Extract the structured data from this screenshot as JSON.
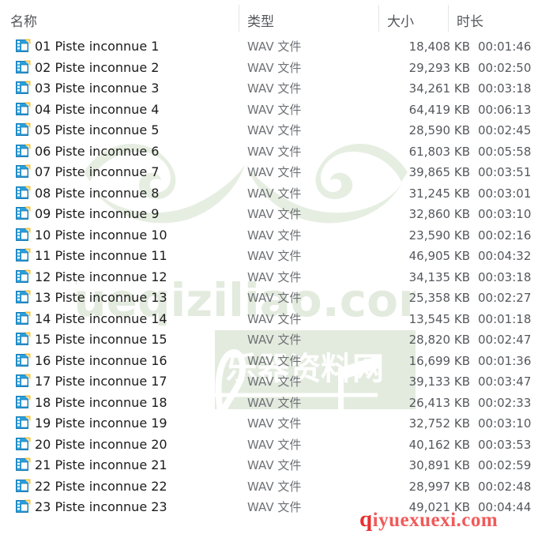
{
  "colors": {
    "header_text": "#53565c",
    "name_text": "#1b1b1b",
    "meta_text": "#55585d",
    "type_text": "#6f7276",
    "separator": "#e3e5e8",
    "background": "#ffffff",
    "icon_blue": "#2b9fda",
    "icon_blue_dark": "#1a7cb5",
    "icon_yellow": "#f5c33b",
    "watermark_green": "#e4ede0",
    "watermark_green_dark": "#d6e4cf",
    "watermark_red": "#f05a5a",
    "watermark_red_accent": "#e8302f"
  },
  "columns": [
    {
      "key": "name",
      "label": "名称"
    },
    {
      "key": "type",
      "label": "类型"
    },
    {
      "key": "size",
      "label": "大小"
    },
    {
      "key": "duration",
      "label": "时长"
    }
  ],
  "watermarks": {
    "green": {
      "site": "Yueqiziliao.com",
      "tagline": "乐器资料网",
      "glyph": "treble-clef"
    },
    "red": {
      "lead": "q",
      "rest": "iyuexuexi.com",
      "full": "qiyuexuexi.com"
    }
  },
  "file_icon_name": "wav-media-file-icon",
  "rows": [
    {
      "name": "01 Piste inconnue 1",
      "type": "WAV 文件",
      "size": "18,408 KB",
      "duration": "00:01:46"
    },
    {
      "name": "02 Piste inconnue 2",
      "type": "WAV 文件",
      "size": "29,293 KB",
      "duration": "00:02:50"
    },
    {
      "name": "03 Piste inconnue 3",
      "type": "WAV 文件",
      "size": "34,261 KB",
      "duration": "00:03:18"
    },
    {
      "name": "04 Piste inconnue 4",
      "type": "WAV 文件",
      "size": "64,419 KB",
      "duration": "00:06:13"
    },
    {
      "name": "05 Piste inconnue 5",
      "type": "WAV 文件",
      "size": "28,590 KB",
      "duration": "00:02:45"
    },
    {
      "name": "06 Piste inconnue 6",
      "type": "WAV 文件",
      "size": "61,803 KB",
      "duration": "00:05:58"
    },
    {
      "name": "07 Piste inconnue 7",
      "type": "WAV 文件",
      "size": "39,865 KB",
      "duration": "00:03:51"
    },
    {
      "name": "08 Piste inconnue 8",
      "type": "WAV 文件",
      "size": "31,245 KB",
      "duration": "00:03:01"
    },
    {
      "name": "09 Piste inconnue 9",
      "type": "WAV 文件",
      "size": "32,860 KB",
      "duration": "00:03:10"
    },
    {
      "name": "10 Piste inconnue 10",
      "type": "WAV 文件",
      "size": "23,590 KB",
      "duration": "00:02:16"
    },
    {
      "name": "11 Piste inconnue 11",
      "type": "WAV 文件",
      "size": "46,905 KB",
      "duration": "00:04:32"
    },
    {
      "name": "12 Piste inconnue 12",
      "type": "WAV 文件",
      "size": "34,135 KB",
      "duration": "00:03:18"
    },
    {
      "name": "13 Piste inconnue 13",
      "type": "WAV 文件",
      "size": "25,358 KB",
      "duration": "00:02:27"
    },
    {
      "name": "14 Piste inconnue 14",
      "type": "WAV 文件",
      "size": "13,545 KB",
      "duration": "00:01:18"
    },
    {
      "name": "15 Piste inconnue 15",
      "type": "WAV 文件",
      "size": "28,820 KB",
      "duration": "00:02:47"
    },
    {
      "name": "16 Piste inconnue 16",
      "type": "WAV 文件",
      "size": "16,699 KB",
      "duration": "00:01:36"
    },
    {
      "name": "17 Piste inconnue 17",
      "type": "WAV 文件",
      "size": "39,133 KB",
      "duration": "00:03:47"
    },
    {
      "name": "18 Piste inconnue 18",
      "type": "WAV 文件",
      "size": "26,413 KB",
      "duration": "00:02:33"
    },
    {
      "name": "19 Piste inconnue 19",
      "type": "WAV 文件",
      "size": "32,752 KB",
      "duration": "00:03:10"
    },
    {
      "name": "20 Piste inconnue 20",
      "type": "WAV 文件",
      "size": "40,162 KB",
      "duration": "00:03:53"
    },
    {
      "name": "21 Piste inconnue 21",
      "type": "WAV 文件",
      "size": "30,891 KB",
      "duration": "00:02:59"
    },
    {
      "name": "22 Piste inconnue 22",
      "type": "WAV 文件",
      "size": "28,997 KB",
      "duration": "00:02:48"
    },
    {
      "name": "23 Piste inconnue 23",
      "type": "WAV 文件",
      "size": "49,021 KB",
      "duration": "00:04:44"
    }
  ]
}
